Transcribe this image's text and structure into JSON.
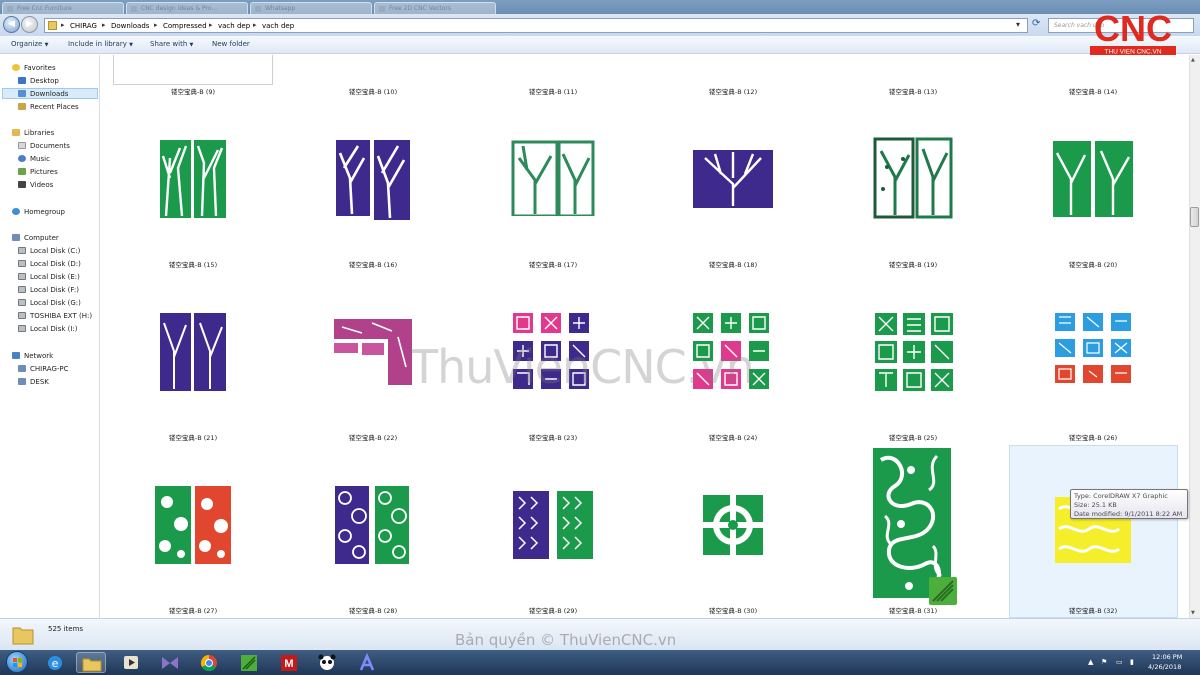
{
  "browser_tabs": [
    {
      "label": "Free Cnc Furniture"
    },
    {
      "label": "CNC design ideas & Pro..."
    },
    {
      "label": "Whatsapp"
    },
    {
      "label": "Free 2D CNC Vectors"
    }
  ],
  "address": {
    "crumbs": [
      "CHIRAG",
      "Downloads",
      "Compressed",
      "vach dep",
      "vach dep"
    ],
    "search_placeholder": "Search vach dep"
  },
  "commands": {
    "organize": "Organize",
    "include_in_library": "Include in library",
    "share_with": "Share with",
    "new_folder": "New folder"
  },
  "nav": {
    "favorites_header": "Favorites",
    "favorites": [
      "Desktop",
      "Downloads",
      "Recent Places"
    ],
    "libraries_header": "Libraries",
    "libraries": [
      "Documents",
      "Music",
      "Pictures",
      "Videos"
    ],
    "homegroup": "Homegroup",
    "computer_header": "Computer",
    "drives": [
      "Local Disk (C:)",
      "Local Disk (D:)",
      "Local Disk (E:)",
      "Local Disk (F:)",
      "Local Disk (G:)",
      "TOSHIBA EXT (H:)",
      "Local Disk (I:)"
    ],
    "network_header": "Network",
    "network": [
      "CHIRAG-PC",
      "DESK"
    ]
  },
  "files": {
    "row0": [
      "镂空宝典-B (9)",
      "镂空宝典-B (10)",
      "镂空宝典-B (11)",
      "镂空宝典-B (12)",
      "镂空宝典-B (13)",
      "镂空宝典-B (14)"
    ],
    "row1": [
      "镂空宝典-B (15)",
      "镂空宝典-B (16)",
      "镂空宝典-B (17)",
      "镂空宝典-B (18)",
      "镂空宝典-B (19)",
      "镂空宝典-B (20)"
    ],
    "row2": [
      "镂空宝典-B (21)",
      "镂空宝典-B (22)",
      "镂空宝典-B (23)",
      "镂空宝典-B (24)",
      "镂空宝典-B (25)",
      "镂空宝典-B (26)"
    ],
    "row3": [
      "镂空宝典-B (27)",
      "镂空宝典-B (28)",
      "镂空宝典-B (29)",
      "镂空宝典-B (30)",
      "镂空宝典-B (31)",
      "镂空宝典-B (32)"
    ]
  },
  "tooltip": {
    "type": "Type: CorelDRAW X7 Graphic",
    "size": "Size: 25.1 KB",
    "date": "Date modified: 9/1/2011 8:22 AM"
  },
  "status": {
    "items": "525 items"
  },
  "clock": {
    "time": "12:06 PM",
    "date": "4/26/2018"
  },
  "watermark": "ThuVienCNC.vn",
  "copyright": "Bản quyền © ThuVienCNC.vn",
  "logo": {
    "mark": "CNC",
    "subtitle": "THU VIEN CNC.VN"
  },
  "colors": {
    "green": "#1a9a4a",
    "purple": "#3d2a8c",
    "pink": "#e0398e",
    "blue": "#2c9de0",
    "red": "#e0472e",
    "yellow": "#f5ee2a",
    "logo_red": "#e02a1f"
  }
}
